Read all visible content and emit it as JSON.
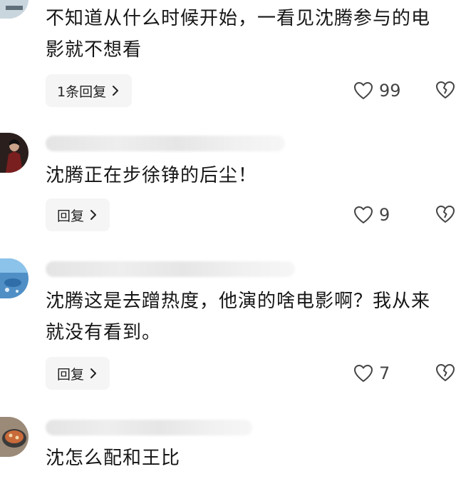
{
  "comments": [
    {
      "text": "不知道从什么时候开始，一看见沈腾参与的电影就不想看",
      "reply_label": "1条回复",
      "likes": "99"
    },
    {
      "text": "沈腾正在步徐铮的后尘！",
      "reply_label": "回复",
      "likes": "9"
    },
    {
      "text": "沈腾这是去蹭热度，他演的啥电影啊？我从来就没有看到。",
      "reply_label": "回复",
      "likes": "7"
    },
    {
      "text": "沈怎么配和王比"
    }
  ],
  "colors": {
    "text": "#161616",
    "reply_bg": "#f5f5f5",
    "icon": "#444444"
  },
  "icons": [
    "heart-outline-icon",
    "broken-heart-icon",
    "chevron-right-icon"
  ]
}
